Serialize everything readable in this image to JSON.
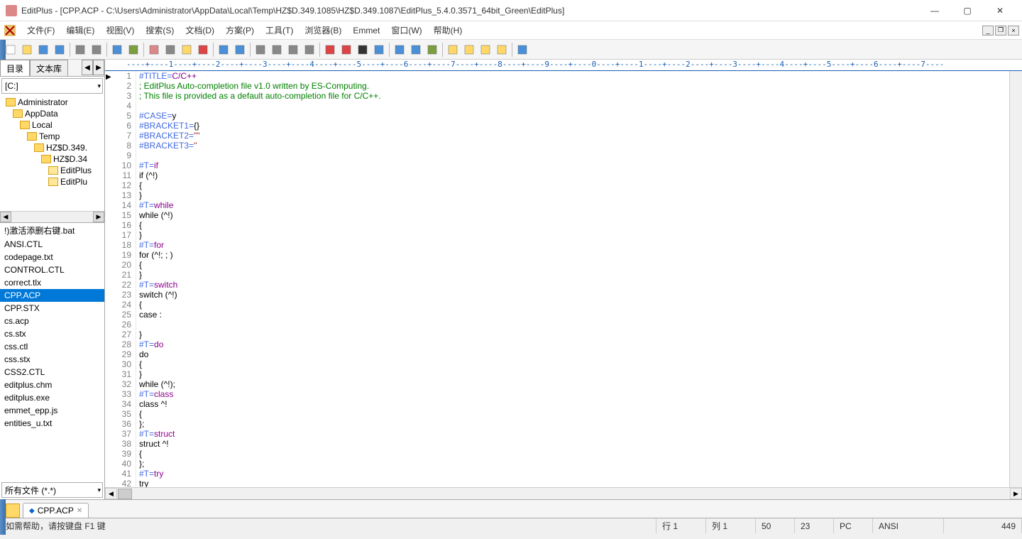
{
  "window": {
    "title": "EditPlus - [CPP.ACP - C:\\Users\\Administrator\\AppData\\Local\\Temp\\HZ$D.349.1085\\HZ$D.349.1087\\EditPlus_5.4.0.3571_64bit_Green\\EditPlus]"
  },
  "menu": {
    "items": [
      "文件(F)",
      "编辑(E)",
      "视图(V)",
      "搜索(S)",
      "文档(D)",
      "方案(P)",
      "工具(T)",
      "浏览器(B)",
      "Emmet",
      "窗口(W)",
      "帮助(H)"
    ]
  },
  "sidebar": {
    "tab_dir": "目录",
    "tab_lib": "文本库",
    "drive": "[C:]",
    "tree": [
      {
        "indent": 0,
        "label": "Administrator"
      },
      {
        "indent": 1,
        "label": "AppData"
      },
      {
        "indent": 2,
        "label": "Local"
      },
      {
        "indent": 3,
        "label": "Temp"
      },
      {
        "indent": 4,
        "label": "HZ$D.349."
      },
      {
        "indent": 5,
        "label": "HZ$D.34"
      },
      {
        "indent": 6,
        "label": "EditPlus"
      },
      {
        "indent": 6,
        "label": "EditPlu"
      }
    ],
    "files": [
      "!)激活添删右键.bat",
      "ANSI.CTL",
      "codepage.txt",
      "CONTROL.CTL",
      "correct.tlx",
      "CPP.ACP",
      "CPP.STX",
      "cs.acp",
      "cs.stx",
      "css.ctl",
      "css.stx",
      "CSS2.CTL",
      "editplus.chm",
      "editplus.exe",
      "emmet_epp.js",
      "entities_u.txt"
    ],
    "selected_file": "CPP.ACP",
    "filter": "所有文件 (*.*)"
  },
  "ruler": "----+----1----+----2----+----3----+----4----+----5----+----6----+----7----+----8----+----9----+----0----+----1----+----2----+----3----+----4----+----5----+----6----+----7----",
  "code_lines": [
    {
      "n": 1,
      "seg": [
        {
          "t": "#TITLE=",
          "c": "dir"
        },
        {
          "t": "C/C++",
          "c": "kw"
        }
      ]
    },
    {
      "n": 2,
      "seg": [
        {
          "t": "; EditPlus Auto-completion file v1.0 written by ES-Computing.",
          "c": "cmt"
        }
      ]
    },
    {
      "n": 3,
      "seg": [
        {
          "t": "; This file is provided as a default auto-completion file for C/C++.",
          "c": "cmt"
        }
      ]
    },
    {
      "n": 4,
      "seg": []
    },
    {
      "n": 5,
      "seg": [
        {
          "t": "#CASE=",
          "c": "dir"
        },
        {
          "t": "y",
          "c": ""
        }
      ]
    },
    {
      "n": 6,
      "seg": [
        {
          "t": "#BRACKET1=",
          "c": "dir"
        },
        {
          "t": "{}",
          "c": ""
        }
      ]
    },
    {
      "n": 7,
      "seg": [
        {
          "t": "#BRACKET2=",
          "c": "dir"
        },
        {
          "t": "\"\"",
          "c": "str"
        }
      ]
    },
    {
      "n": 8,
      "seg": [
        {
          "t": "#BRACKET3=",
          "c": "dir"
        },
        {
          "t": "''",
          "c": "str"
        }
      ]
    },
    {
      "n": 9,
      "seg": []
    },
    {
      "n": 10,
      "seg": [
        {
          "t": "#T=",
          "c": "dir"
        },
        {
          "t": "if",
          "c": "kw"
        }
      ]
    },
    {
      "n": 11,
      "seg": [
        {
          "t": "if (^!)",
          "c": ""
        }
      ]
    },
    {
      "n": 12,
      "seg": [
        {
          "t": "{",
          "c": ""
        }
      ]
    },
    {
      "n": 13,
      "seg": [
        {
          "t": "}",
          "c": ""
        }
      ]
    },
    {
      "n": 14,
      "seg": [
        {
          "t": "#T=",
          "c": "dir"
        },
        {
          "t": "while",
          "c": "kw"
        }
      ]
    },
    {
      "n": 15,
      "seg": [
        {
          "t": "while (^!)",
          "c": ""
        }
      ]
    },
    {
      "n": 16,
      "seg": [
        {
          "t": "{",
          "c": ""
        }
      ]
    },
    {
      "n": 17,
      "seg": [
        {
          "t": "}",
          "c": ""
        }
      ]
    },
    {
      "n": 18,
      "seg": [
        {
          "t": "#T=",
          "c": "dir"
        },
        {
          "t": "for",
          "c": "kw"
        }
      ]
    },
    {
      "n": 19,
      "seg": [
        {
          "t": "for (^!; ; )",
          "c": ""
        }
      ]
    },
    {
      "n": 20,
      "seg": [
        {
          "t": "{",
          "c": ""
        }
      ]
    },
    {
      "n": 21,
      "seg": [
        {
          "t": "}",
          "c": ""
        }
      ]
    },
    {
      "n": 22,
      "seg": [
        {
          "t": "#T=",
          "c": "dir"
        },
        {
          "t": "switch",
          "c": "kw"
        }
      ]
    },
    {
      "n": 23,
      "seg": [
        {
          "t": "switch (^!)",
          "c": ""
        }
      ]
    },
    {
      "n": 24,
      "seg": [
        {
          "t": "{",
          "c": ""
        }
      ]
    },
    {
      "n": 25,
      "seg": [
        {
          "t": "case :",
          "c": ""
        }
      ]
    },
    {
      "n": 26,
      "seg": []
    },
    {
      "n": 27,
      "seg": [
        {
          "t": "}",
          "c": ""
        }
      ]
    },
    {
      "n": 28,
      "seg": [
        {
          "t": "#T=",
          "c": "dir"
        },
        {
          "t": "do",
          "c": "kw"
        }
      ]
    },
    {
      "n": 29,
      "seg": [
        {
          "t": "do",
          "c": ""
        }
      ]
    },
    {
      "n": 30,
      "seg": [
        {
          "t": "{",
          "c": ""
        }
      ]
    },
    {
      "n": 31,
      "seg": [
        {
          "t": "}",
          "c": ""
        }
      ]
    },
    {
      "n": 32,
      "seg": [
        {
          "t": "while (^!);",
          "c": ""
        }
      ]
    },
    {
      "n": 33,
      "seg": [
        {
          "t": "#T=",
          "c": "dir"
        },
        {
          "t": "class",
          "c": "kw"
        }
      ]
    },
    {
      "n": 34,
      "seg": [
        {
          "t": "class ^!",
          "c": ""
        }
      ]
    },
    {
      "n": 35,
      "seg": [
        {
          "t": "{",
          "c": ""
        }
      ]
    },
    {
      "n": 36,
      "seg": [
        {
          "t": "};",
          "c": ""
        }
      ]
    },
    {
      "n": 37,
      "seg": [
        {
          "t": "#T=",
          "c": "dir"
        },
        {
          "t": "struct",
          "c": "kw"
        }
      ]
    },
    {
      "n": 38,
      "seg": [
        {
          "t": "struct ^!",
          "c": ""
        }
      ]
    },
    {
      "n": 39,
      "seg": [
        {
          "t": "{",
          "c": ""
        }
      ]
    },
    {
      "n": 40,
      "seg": [
        {
          "t": "};",
          "c": ""
        }
      ]
    },
    {
      "n": 41,
      "seg": [
        {
          "t": "#T=",
          "c": "dir"
        },
        {
          "t": "try",
          "c": "kw"
        }
      ]
    },
    {
      "n": 42,
      "seg": [
        {
          "t": "try",
          "c": ""
        }
      ]
    }
  ],
  "doctab": {
    "name": "CPP.ACP"
  },
  "status": {
    "help": "如需帮助，请按键盘 F1 键",
    "line": "行 1",
    "col": "列 1",
    "v1": "50",
    "v2": "23",
    "pc": "PC",
    "enc": "ANSI",
    "sz": "449"
  },
  "toolbar_icons": [
    "new",
    "open",
    "save",
    "saveall",
    "|",
    "print",
    "preview",
    "|",
    "browser",
    "ftp",
    "|",
    "cut",
    "copy",
    "paste",
    "delete",
    "|",
    "undo",
    "redo",
    "|",
    "find",
    "findnext",
    "replace",
    "goto",
    "|",
    "font-dec",
    "font",
    "hex",
    "wrap",
    "|",
    "indent",
    "outdent",
    "spell",
    "|",
    "win1",
    "win2",
    "win3",
    "win4",
    "|",
    "help"
  ]
}
